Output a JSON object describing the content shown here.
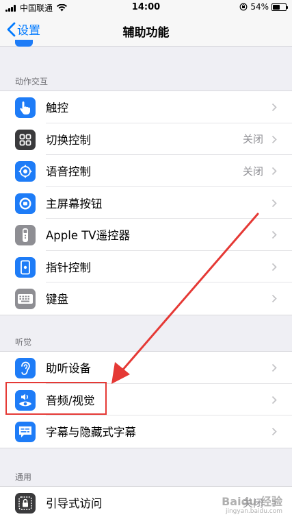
{
  "status_bar": {
    "carrier": "中国联通",
    "time": "14:00",
    "battery": "54%",
    "battery_level": 0.54
  },
  "nav": {
    "back_label": "设置",
    "title": "辅助功能"
  },
  "sections": [
    {
      "header": "动作交互",
      "rows": [
        {
          "label": "触控",
          "value": "",
          "icon": "hand-touch-icon",
          "color": "#1e7cf7"
        },
        {
          "label": "切换控制",
          "value": "关闭",
          "icon": "switch-control-icon",
          "color": "#3a3a3c"
        },
        {
          "label": "语音控制",
          "value": "关闭",
          "icon": "voice-control-icon",
          "color": "#1e7cf7"
        },
        {
          "label": "主屏幕按钮",
          "value": "",
          "icon": "home-button-icon",
          "color": "#1e7cf7"
        },
        {
          "label": "Apple TV遥控器",
          "value": "",
          "icon": "remote-icon",
          "color": "#8e8e93"
        },
        {
          "label": "指针控制",
          "value": "",
          "icon": "pointer-icon",
          "color": "#1e7cf7"
        },
        {
          "label": "键盘",
          "value": "",
          "icon": "keyboard-icon",
          "color": "#8e8e93"
        }
      ]
    },
    {
      "header": "听觉",
      "rows": [
        {
          "label": "助听设备",
          "value": "",
          "icon": "ear-icon",
          "color": "#1e7cf7"
        },
        {
          "label": "音频/视觉",
          "value": "",
          "icon": "audio-visual-icon",
          "color": "#1e7cf7"
        },
        {
          "label": "字幕与隐藏式字幕",
          "value": "",
          "icon": "subtitles-icon",
          "color": "#1e7cf7"
        }
      ]
    },
    {
      "header": "通用",
      "rows": [
        {
          "label": "引导式访问",
          "value": "关闭",
          "icon": "guided-access-icon",
          "color": "#3a3a3c"
        }
      ]
    }
  ],
  "watermark": {
    "text": "Baidu 经验",
    "sub": "jingyan.baidu.com"
  }
}
